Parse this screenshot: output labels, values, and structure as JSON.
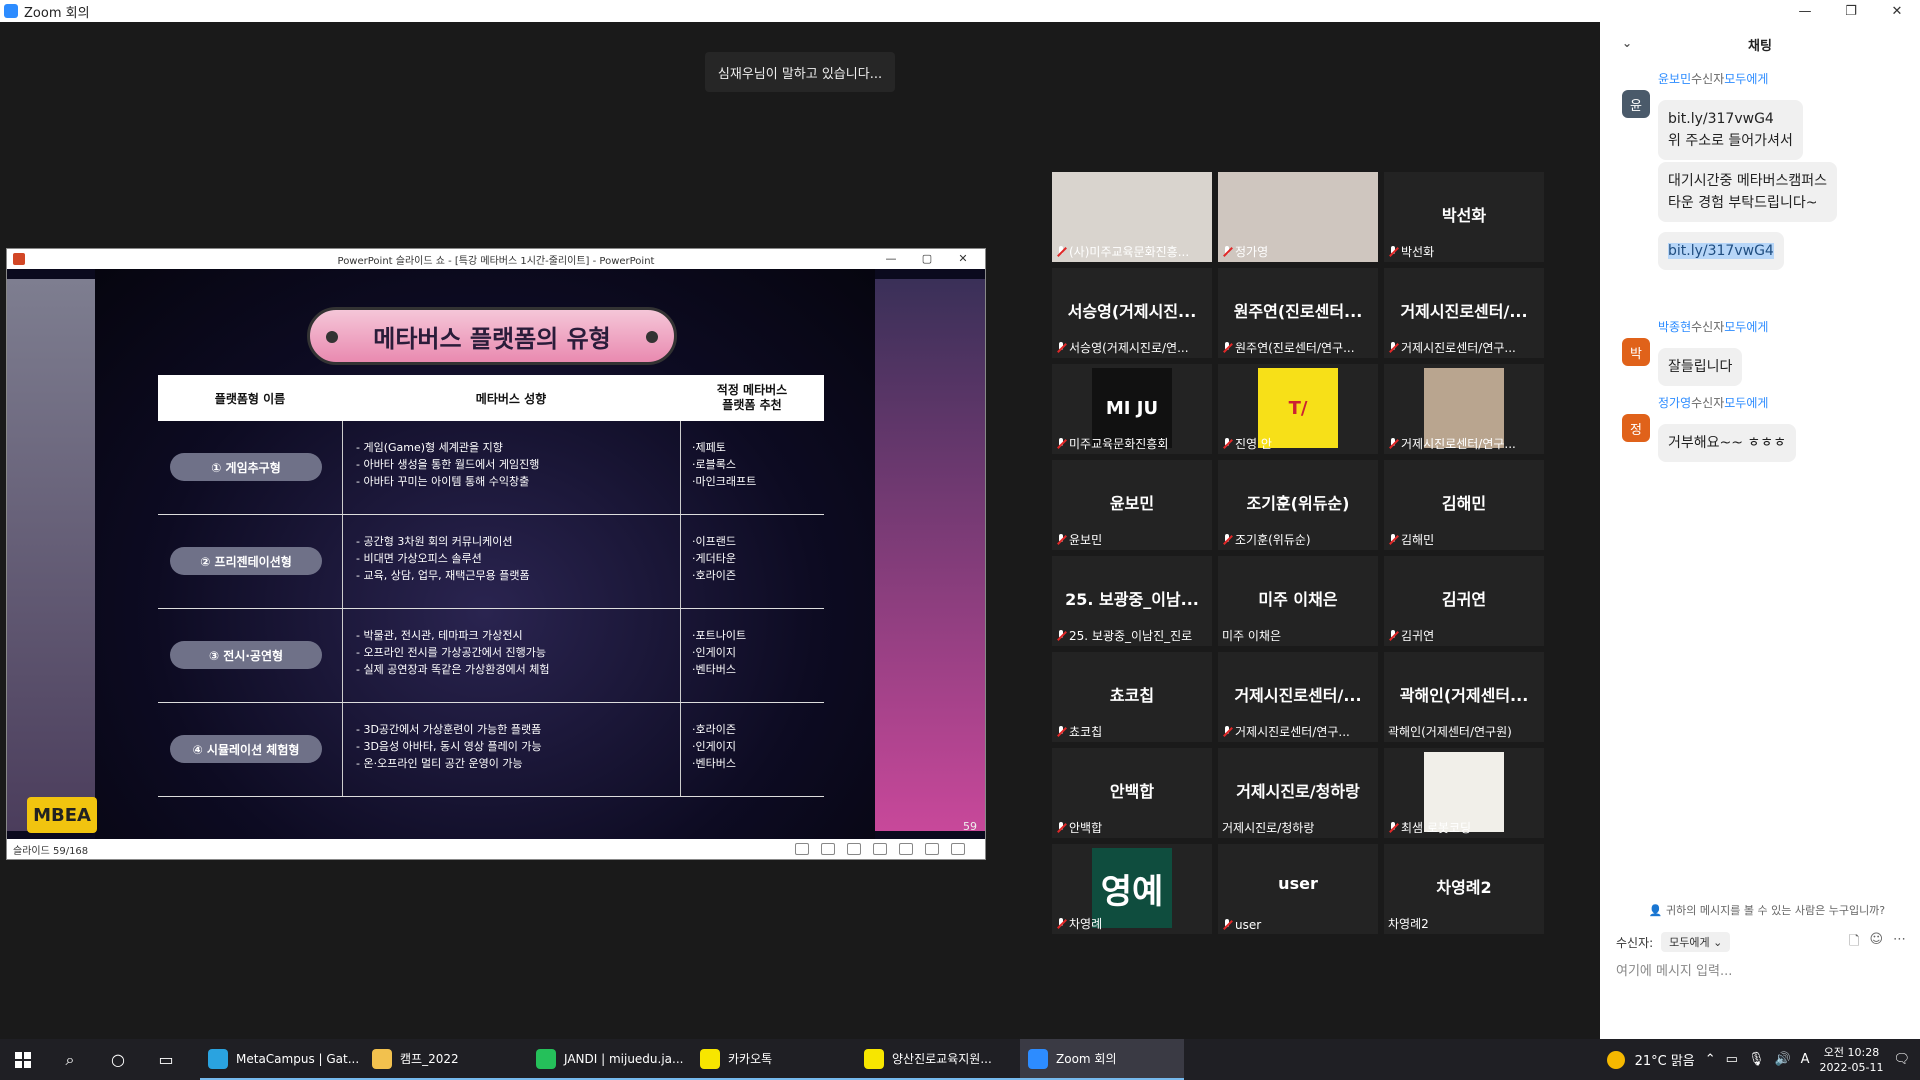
{
  "window": {
    "title": "Zoom 회의"
  },
  "stage": {
    "speaking_banner": "심재우님이 말하고 있습니다..."
  },
  "ppt": {
    "title": "PowerPoint 슬라이드 쇼 - [특강 메타버스 1시간-줄리이트] - PowerPoint",
    "status": "슬라이드 59/168",
    "slide_title": "메타버스 플랫폼의 유형",
    "headers": [
      "플랫폼형 이름",
      "메타버스 성향",
      "적정 메타버스\n플랫폼 추천"
    ],
    "rows": [
      {
        "type": "① 게임추구형",
        "desc": [
          "- 게임(Game)형 세계관을 지향",
          "- 아바타 생성을 통한 월드에서 게임진행",
          "- 아바타 꾸미는 아이템 통해 수익창출"
        ],
        "platforms": [
          "·제페토",
          "·로블록스",
          "·마인크래프트"
        ]
      },
      {
        "type": "② 프리젠테이션형",
        "desc": [
          "- 공간형 3차원 회의 커뮤니케이션",
          "- 비대면 가상오피스 솔루션",
          "- 교육, 상담, 업무, 재택근무용 플랫폼"
        ],
        "platforms": [
          "·이프랜드",
          "·게더타운",
          "·호라이즌"
        ]
      },
      {
        "type": "③ 전시·공연형",
        "desc": [
          "- 박물관, 전시관, 테마파크 가상전시",
          "- 오프라인 전시를 가상공간에서 진행가능",
          "- 실제 공연장과 똑같은 가상환경에서 체험"
        ],
        "platforms": [
          "·포트나이트",
          "·인게이지",
          "·벤타버스"
        ]
      },
      {
        "type": "④ 시뮬레이션 체험형",
        "desc": [
          "- 3D공간에서 가상훈련이 가능한 플랫폼",
          "- 3D음성 아바타, 동시 영상 플레이 가능",
          "- 온·오프라인 멀티 공간 운영이 가능"
        ],
        "platforms": [
          "·호라이즌",
          "·인게이지",
          "·벤타버스"
        ]
      }
    ],
    "page_number": "59",
    "logo_text": "MBEA"
  },
  "gallery": [
    {
      "name": "",
      "label": "(사)미주교육문화진흥...",
      "muted": true,
      "photo": "#d9d4ce"
    },
    {
      "name": "",
      "label": "정가영",
      "muted": true,
      "photo": "#cfc6bf"
    },
    {
      "name": "박선화",
      "label": "박선화",
      "muted": true
    },
    {
      "name": "서승영(거제시진...",
      "label": "서승영(거제시진로/연...",
      "muted": true
    },
    {
      "name": "원주연(진로센터...",
      "label": "원주연(진로센터/연구...",
      "muted": true
    },
    {
      "name": "거제시진로센터/...",
      "label": "거제시진로센터/연구...",
      "muted": true
    },
    {
      "name": "",
      "label": "미주교육문화진흥회",
      "muted": true,
      "logo": "MI JU",
      "logo_bg": "#111111"
    },
    {
      "name": "",
      "label": "진영 안",
      "muted": true,
      "logo": "T/",
      "logo_bg": "#f7e018"
    },
    {
      "name": "",
      "label": "거제시진로센터/연구...",
      "muted": true,
      "logo": "",
      "logo_bg": "#b9a58f"
    },
    {
      "name": "윤보민",
      "label": "윤보민",
      "muted": true
    },
    {
      "name": "조기훈(위듀순)",
      "label": "조기훈(위듀순)",
      "muted": true
    },
    {
      "name": "김해민",
      "label": "김해민",
      "muted": true
    },
    {
      "name": "25. 보광중_이남...",
      "label": "25. 보광중_이남진_진로",
      "muted": true
    },
    {
      "name": "미주 이채은",
      "label": "미주 이채은",
      "muted": false
    },
    {
      "name": "김귀연",
      "label": "김귀연",
      "muted": true
    },
    {
      "name": "쵸코칩",
      "label": "쵸코칩",
      "muted": true
    },
    {
      "name": "거제시진로센터/...",
      "label": "거제시진로센터/연구...",
      "muted": true
    },
    {
      "name": "곽해인(거제센터...",
      "label": "곽해인(거제센터/연구원)",
      "muted": false
    },
    {
      "name": "안백합",
      "label": "안백합",
      "muted": true
    },
    {
      "name": "거제시진로/청하랑",
      "label": "거제시진로/청하랑",
      "muted": false
    },
    {
      "name": "",
      "label": "최샘 로봇코딩",
      "muted": true,
      "logo": "",
      "logo_bg": "#f1efe9"
    },
    {
      "name": "",
      "label": "차영례",
      "muted": true,
      "logo": "영예",
      "logo_bg": "#0f4d3e"
    },
    {
      "name": "user",
      "label": "user",
      "muted": true
    },
    {
      "name": "차영례2",
      "label": "차영례2",
      "muted": false
    }
  ],
  "chat": {
    "title": "채팅",
    "messages": [
      {
        "sender": "윤보민",
        "to_prefix": "수신자",
        "to": "모두에게",
        "avatar": "윤",
        "avatar_color": "#4a5a6a",
        "bubbles": [
          [
            "bit.ly/317vwG4",
            "위 주소로 들어가셔서"
          ],
          [
            "대기시간중 메타버스캠퍼스",
            "타운 경험 부탁드립니다~"
          ],
          [
            "bit.ly/317vwG4"
          ]
        ]
      },
      {
        "sender": "박종현",
        "to_prefix": "수신자",
        "to": "모두에게",
        "avatar": "박",
        "avatar_color": "#e0621a",
        "bubbles": [
          [
            "잘들립니다"
          ]
        ]
      },
      {
        "sender": "정가영",
        "to_prefix": "수신자",
        "to": "모두에게",
        "avatar": "정",
        "avatar_color": "#e0621a",
        "bubbles": [
          [
            "거부해요~~ ㅎㅎㅎ"
          ]
        ]
      }
    ],
    "who_can_see": "귀하의 메시지를 볼 수 있는 사람은 누구입니까?",
    "recipient_label": "수신자:",
    "recipient_value": "모두에게",
    "input_placeholder": "여기에 메시지 입력..."
  },
  "taskbar": {
    "apps": [
      {
        "label": "MetaCampus | Gat...",
        "color": "#2aa3e0"
      },
      {
        "label": "캠프_2022",
        "color": "#f2c14e"
      },
      {
        "label": "JANDI | mijuedu.ja...",
        "color": "#25c05a"
      },
      {
        "label": "카카오톡",
        "color": "#f7e600"
      },
      {
        "label": "양산진로교육지원...",
        "color": "#f7e600"
      },
      {
        "label": "Zoom 회의",
        "color": "#2d8cff"
      }
    ],
    "weather": "21°C 맑음",
    "ime": "A",
    "time": "오전 10:28",
    "date": "2022-05-11"
  }
}
